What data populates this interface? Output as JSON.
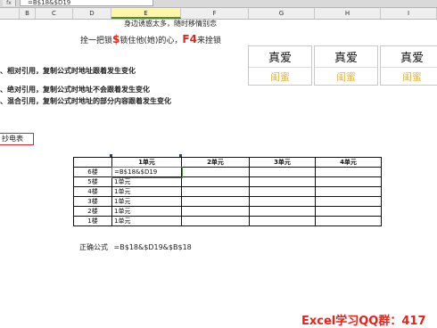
{
  "formula_bar": {
    "label": "fx",
    "value": "=B$18&$D19"
  },
  "columns": [
    "B",
    "C",
    "D",
    "E",
    "F",
    "G",
    "H",
    "I"
  ],
  "selected_column": "E",
  "intro": {
    "line1": "身边诱惑太多，随时移情别恋",
    "line2_a": "拴一把锁",
    "line2_dollar": "$",
    "line2_b": "锁住他(她)的心，",
    "line2_key": "F4",
    "line2_c": "来拴锁"
  },
  "notes": [
    "、相对引用，复制公式时地址跟着发生变化",
    "、绝对引用，复制公式时地址不会跟着发生变化",
    "、混合引用，复制公式时地址的部分内容跟着发生变化"
  ],
  "cards": [
    {
      "top": "真爱",
      "bottom": "闺蜜"
    },
    {
      "top": "真爱",
      "bottom": "闺蜜"
    },
    {
      "top": "真爱",
      "bottom": "闺蜜"
    }
  ],
  "sidebox": "抄电表",
  "table": {
    "headers": [
      "",
      "1单元",
      "2单元",
      "3单元",
      "4单元"
    ],
    "rows": [
      [
        "6楼",
        "=B$18&$D19",
        "",
        "",
        ""
      ],
      [
        "5楼",
        "1单元",
        "",
        "",
        ""
      ],
      [
        "4楼",
        "1单元",
        "",
        "",
        ""
      ],
      [
        "3楼",
        "1单元",
        "",
        "",
        ""
      ],
      [
        "2楼",
        "1单元",
        "",
        "",
        ""
      ],
      [
        "1楼",
        "1单元",
        "",
        "",
        ""
      ]
    ]
  },
  "correct_formula": {
    "label": "正确公式",
    "value": "=B$18&$D19&$B$18"
  },
  "footer": "Excel学习QQ群：417"
}
